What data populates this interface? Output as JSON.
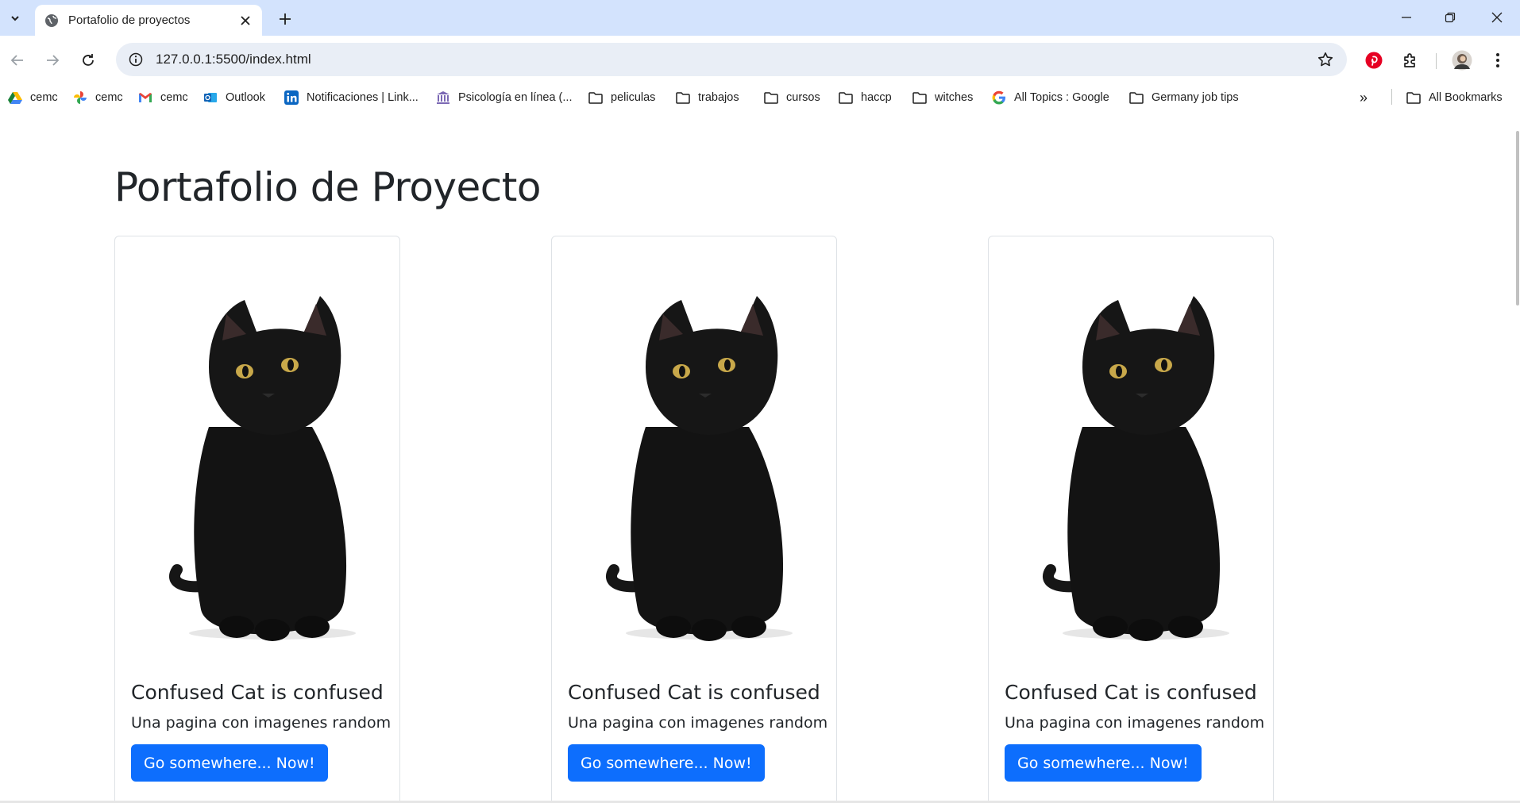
{
  "browser": {
    "tab": {
      "title": "Portafolio de proyectos"
    },
    "address": {
      "url": "127.0.0.1:5500/index.html"
    },
    "bookmarks": [
      {
        "label": "cemc",
        "icon": "google-drive-icon"
      },
      {
        "label": "cemc",
        "icon": "google-photos-icon"
      },
      {
        "label": "cemc",
        "icon": "gmail-icon"
      },
      {
        "label": "Outlook",
        "icon": "outlook-icon"
      },
      {
        "label": "Notificaciones | Link...",
        "icon": "linkedin-icon"
      },
      {
        "label": "Psicología en línea (...",
        "icon": "university-icon"
      },
      {
        "label": "peliculas",
        "icon": "folder-icon"
      },
      {
        "label": "trabajos",
        "icon": "folder-icon"
      },
      {
        "label": "cursos",
        "icon": "folder-icon"
      },
      {
        "label": "haccp",
        "icon": "folder-icon"
      },
      {
        "label": "witches",
        "icon": "folder-icon"
      },
      {
        "label": "All Topics : Google",
        "icon": "google-icon"
      },
      {
        "label": "Germany job tips",
        "icon": "folder-icon"
      }
    ],
    "all_bookmarks_label": "All Bookmarks",
    "overflow_label": "»"
  },
  "page": {
    "title": "Portafolio de Proyecto",
    "cards": [
      {
        "title": "Confused Cat is confused",
        "text": "Una pagina con imagenes random",
        "button": "Go somewhere... Now!"
      },
      {
        "title": "Confused Cat is confused",
        "text": "Una pagina con imagenes random",
        "button": "Go somewhere... Now!"
      },
      {
        "title": "Confused Cat is confused",
        "text": "Una pagina con imagenes random",
        "button": "Go somewhere... Now!"
      }
    ]
  },
  "colors": {
    "tabstrip": "#d3e3fd",
    "omnibox": "#e9eef6",
    "primary_button": "#0d6efd",
    "pinterest": "#e60023"
  }
}
